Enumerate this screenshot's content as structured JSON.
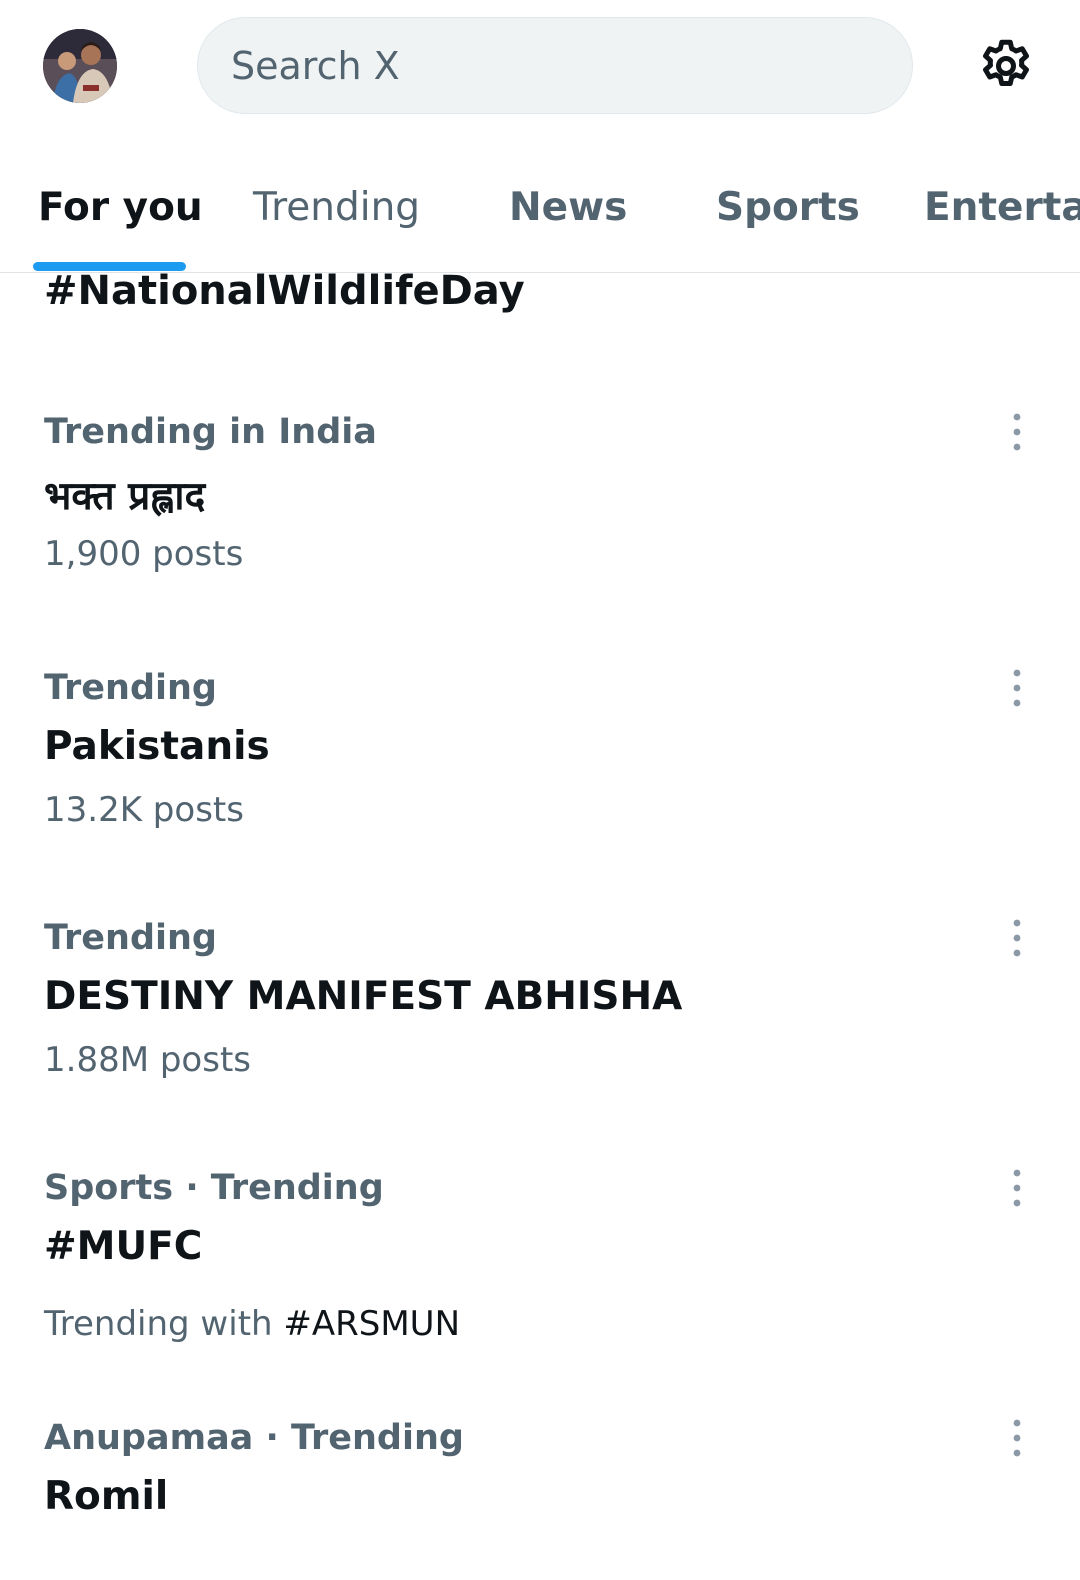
{
  "search": {
    "placeholder": "Search X"
  },
  "tabs": [
    {
      "label": "For you",
      "active": true
    },
    {
      "label": "Trending",
      "active": false
    },
    {
      "label": "News",
      "active": false
    },
    {
      "label": "Sports",
      "active": false
    },
    {
      "label": "Entertai",
      "active": false
    }
  ],
  "partial_trend": {
    "name": "#NationalWildlifeDay"
  },
  "trends": [
    {
      "context": "Trending in India",
      "name": "भक्त प्रह्लाद",
      "meta": "1,900 posts"
    },
    {
      "context": "Trending",
      "name": "Pakistanis",
      "meta": "13.2K posts"
    },
    {
      "context": "Trending",
      "name": "DESTINY MANIFEST ABHISHA",
      "meta": "1.88M posts"
    },
    {
      "context": "Sports · Trending",
      "name": "#MUFC",
      "meta_prefix": "Trending with ",
      "meta_hashtag": "#ARSMUN"
    },
    {
      "context": "Anupamaa · Trending",
      "name": "Romil"
    }
  ],
  "icons": {
    "avatar": "profile-avatar",
    "settings": "gear-icon",
    "more": "more-vertical-icon"
  },
  "colors": {
    "accent": "#1d9bf0",
    "text_primary": "#0f1419",
    "text_secondary": "#536471",
    "search_bg": "#eff3f4"
  }
}
